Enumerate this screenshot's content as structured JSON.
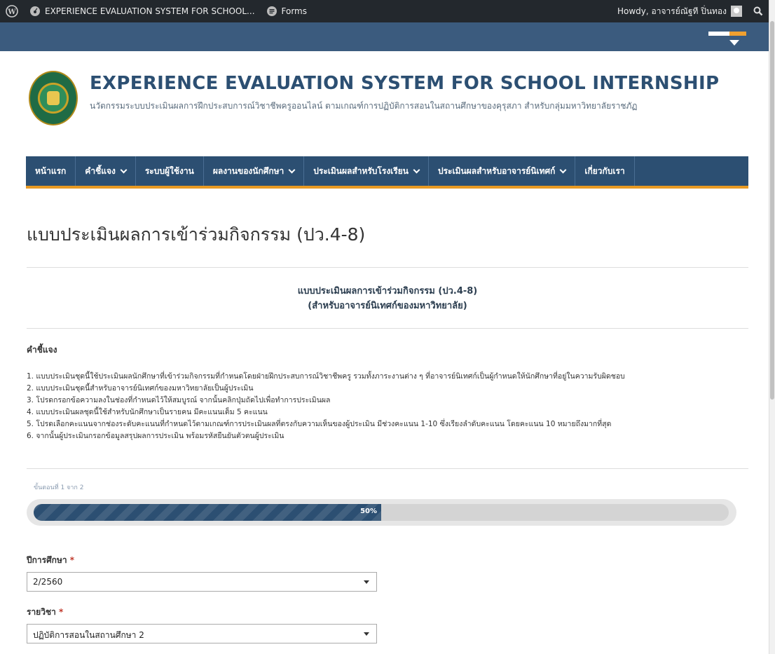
{
  "admin_bar": {
    "site_name": "EXPERIENCE EVALUATION SYSTEM FOR SCHOOL...",
    "forms_label": "Forms",
    "greeting": "Howdy, อาจารย์ณัฐที ปิ่นทอง"
  },
  "header": {
    "site_title": "EXPERIENCE EVALUATION SYSTEM FOR SCHOOL INTERNSHIP",
    "site_description": "นวัตกรรมระบบประเมินผลการฝึกประสบการณ์วิชาชีพครูออนไลน์ ตามเกณฑ์การปฏิบัติการสอนในสถานศึกษาของคุรุสภา สำหรับกลุ่มมหาวิทยาลัยราชภัฏ"
  },
  "nav": {
    "items": [
      {
        "label": "หน้าแรก",
        "dropdown": false
      },
      {
        "label": "คำชี้แจง",
        "dropdown": true
      },
      {
        "label": "ระบบผู้ใช้งาน",
        "dropdown": false
      },
      {
        "label": "ผลงานของนักศึกษา",
        "dropdown": true
      },
      {
        "label": "ประเมินผลสำหรับโรงเรียน",
        "dropdown": true
      },
      {
        "label": "ประเมินผลสำหรับอาจารย์นิเทศก์",
        "dropdown": true
      },
      {
        "label": "เกี่ยวกับเรา",
        "dropdown": false
      }
    ]
  },
  "page": {
    "title": "แบบประเมินผลการเข้าร่วมกิจกรรม (ปว.4-8)"
  },
  "form": {
    "title_line1": "แบบประเมินผลการเข้าร่วมกิจกรรม (ปว.4-8)",
    "title_line2": "(สำหรับอาจารย์นิเทศก์ของมหาวิทยาลัย)",
    "instructions_heading": "คำชี้แจง",
    "instructions": [
      "1. แบบประเมินชุดนี้ใช้ประเมินผลนักศึกษาที่เข้าร่วมกิจกรรมที่กำหนดโดยฝ่ายฝึกประสบการณ์วิชาชีพครู รวมทั้งภาระงานต่าง ๆ ที่อาจารย์นิเทศก์เป็นผู้กำหนดให้นักศึกษาที่อยู่ในความรับผิดชอบ",
      "2. แบบประเมินชุดนี้สำหรับอาจารย์นิเทศก์ของมหาวิทยาลัยเป็นผู้ประเมิน",
      "3. โปรดกรอกข้อความลงในช่องที่กำหนดไว้ให้สมบูรณ์ จากนั้นคลิกปุ่มถัดไปเพื่อทำการประเมินผล",
      "4. แบบประเมินผลชุดนี้ใช้สำหรับนักศึกษาเป็นรายคน มีคะแนนเต็ม 5 คะแนน",
      "5. โปรดเลือกคะแนนจากช่องระดับคะแนนที่กำหนดไว้ตามเกณฑ์การประเมินผลที่ตรงกับความเห็นของผู้ประเมิน มีช่วงคะแนน 1-10 ซึ่งเรียงลำดับคะแนน โดยคะแนน 10 หมายถึงมากที่สุด",
      "6. จากนั้นผู้ประเมินกรอกข้อมูลสรุปผลการประเมิน พร้อมรหัสยืนยันตัวตนผู้ประเมิน"
    ],
    "step_label": "ขั้นตอนที่ 1 จาก 2",
    "progress_value": 0.5,
    "progress_text": "50%",
    "fields": [
      {
        "label": "ปีการศึกษา",
        "required_mark": "*",
        "value": "2/2560"
      },
      {
        "label": "รายวิชา",
        "required_mark": "*",
        "value": "ปฏิบัติการสอนในสถานศึกษา 2"
      }
    ]
  },
  "colors": {
    "primary": "#2c4f72",
    "accent": "#e89a23",
    "admin_bar": "#23282d"
  }
}
